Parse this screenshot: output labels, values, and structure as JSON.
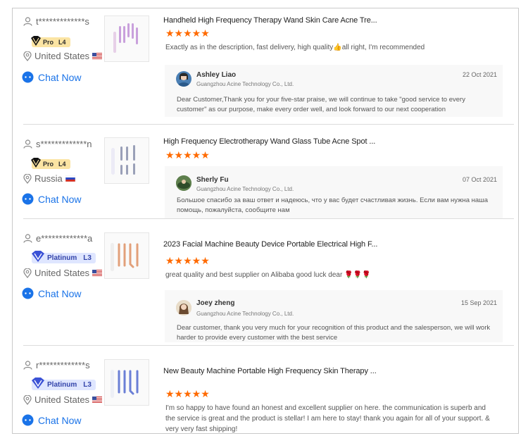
{
  "reviews": [
    {
      "user": "t*************s",
      "badge_type": "Pro",
      "badge_level": "L4",
      "country": "United States",
      "chat_label": "Chat Now",
      "product_title": "Handheld High Frequency Therapy Wand Skin Care Acne Tre...",
      "stars": "★★★★★",
      "rating": 5,
      "content": "Exactly as in the description, fast delivery, high quality👍all right, I'm recommended",
      "reply": {
        "name": "Ashley Liao",
        "company": "Guangzhou Acine Technology Co., Ltd.",
        "date": "22 Oct 2021",
        "text": "Dear Customer,Thank you for your five-star praise, we will continue to take \"good service to every customer\" as our purpose, make every order well, and look forward to our next cooperation"
      }
    },
    {
      "user": "s*************n",
      "badge_type": "Pro",
      "badge_level": "L4",
      "country": "Russia",
      "chat_label": "Chat Now",
      "product_title": "High Frequency Electrotherapy Wand Glass Tube Acne Spot ...",
      "stars": "★★★★★",
      "rating": 5,
      "content": "",
      "reply": {
        "name": "Sherly Fu",
        "company": "Guangzhou Acine Technology Co., Ltd.",
        "date": "07 Oct 2021",
        "text": "Большое спасибо за ваш ответ и надеюсь, что у вас будет счастливая жизнь. Если вам нужна наша помощь, пожалуйста, сообщите нам"
      }
    },
    {
      "user": "e*************a",
      "badge_type": "Platinum",
      "badge_level": "L3",
      "country": "United States",
      "chat_label": "Chat Now",
      "product_title": "2023 Facial Machine Beauty Device Portable Electrical High F...",
      "stars": "★★★★★",
      "rating": 5,
      "content": "great quality and best supplier on Alibaba good luck dear 🌹🌹🌹",
      "reply": {
        "name": "Joey zheng",
        "company": "Guangzhou Acine Technology Co., Ltd.",
        "date": "15 Sep 2021",
        "text": "Dear customer, thank you very much for your recognition of this product and the salesperson, we will work harder to provide every customer with the best service"
      }
    },
    {
      "user": "r*************s",
      "badge_type": "Platinum",
      "badge_level": "L3",
      "country": "United States",
      "chat_label": "Chat Now",
      "product_title": "New Beauty Machine Portable High Frequency Skin Therapy ...",
      "stars": "★★★★★",
      "rating": 5,
      "content": "I'm so happy to have found an honest and excellent supplier on here. the communication is superb and the service is great and the product is stellar! I am here to stay! thank you again for all of your support. & very very fast shipping!"
    }
  ],
  "colors": {
    "star": "#ff6a00",
    "chat": "#1a73e8",
    "pro_badge": "#fbe4a3",
    "platinum_badge": "#dfe6ff"
  },
  "icons": [
    "user-icon",
    "location-icon",
    "chat-bubble-icon",
    "diamond-icon",
    "flag-icon"
  ]
}
